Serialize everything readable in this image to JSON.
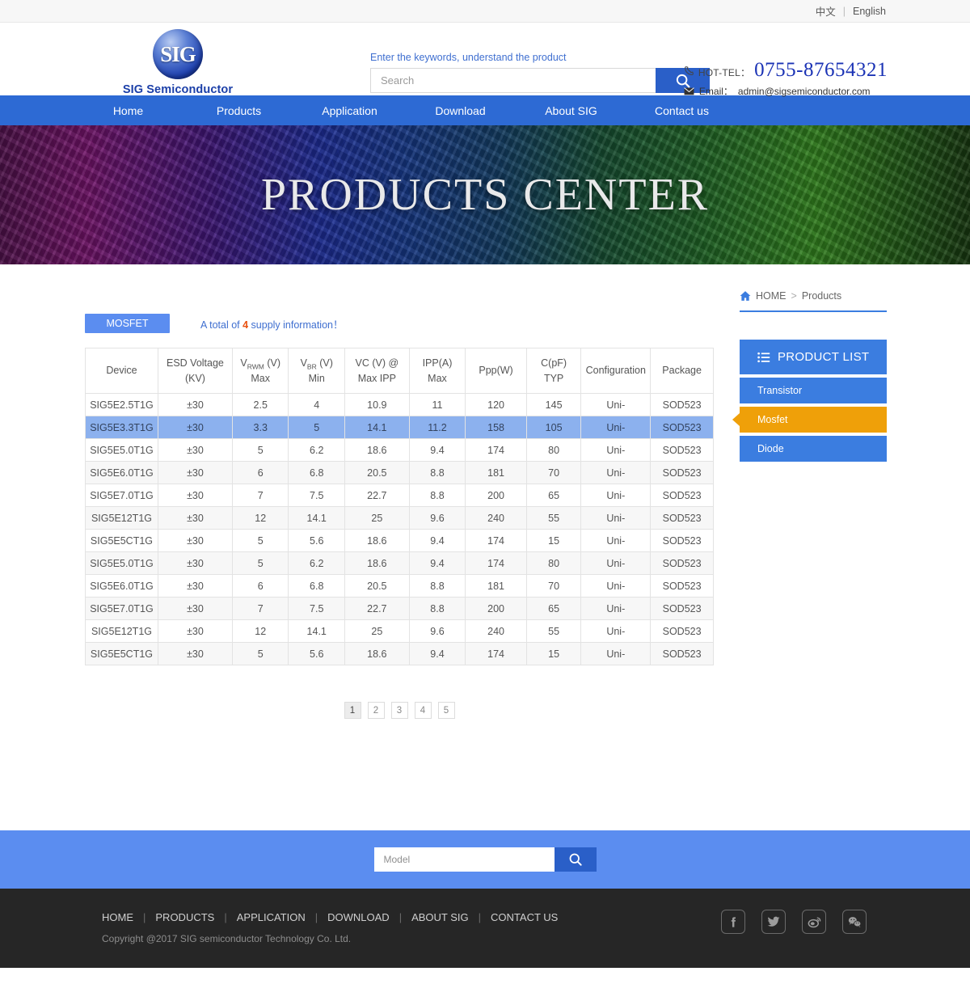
{
  "topbar": {
    "chinese": "中文",
    "separator": "|",
    "english": "English"
  },
  "header": {
    "logo_mark": "SIG",
    "logo_text": "SIG Semiconductor",
    "search_tagline": "Enter the keywords, understand the product",
    "search_placeholder": "Search",
    "search_value": "",
    "tel_label": "HOT-TEL：",
    "tel_number": "0755-87654321",
    "email_label": "Email：",
    "email_value": "admin@sigsemiconductor.com"
  },
  "nav": {
    "items": [
      {
        "label": "Home"
      },
      {
        "label": "Products"
      },
      {
        "label": "Application"
      },
      {
        "label": "Download"
      },
      {
        "label": "About SIG"
      },
      {
        "label": "Contact us"
      }
    ]
  },
  "banner": {
    "title": "PRODUCTS CENTER"
  },
  "content": {
    "tab_label": "MOSFET",
    "total_prefix": "A total of ",
    "total_count": "4",
    "total_suffix": " supply information！",
    "table": {
      "headers": [
        {
          "line1": "Device",
          "line2": ""
        },
        {
          "line1": "ESD Voltage",
          "line2": "(KV)"
        },
        {
          "line1": "V_RWM (V)",
          "line2": "Max",
          "sub_base": "V",
          "sub": "RWM",
          "sub_tail": " (V)"
        },
        {
          "line1": "V_BR (V)",
          "line2": "Min",
          "sub_base": "V",
          "sub": "BR",
          "sub_tail": " (V)"
        },
        {
          "line1": "VC (V) @",
          "line2": "Max IPP"
        },
        {
          "line1": "IPP(A)",
          "line2": "Max"
        },
        {
          "line1": "Ppp(W)",
          "line2": ""
        },
        {
          "line1": "C(pF)",
          "line2": "TYP"
        },
        {
          "line1": "Configuration",
          "line2": ""
        },
        {
          "line1": "Package",
          "line2": ""
        }
      ],
      "rows": [
        {
          "active": false,
          "cells": [
            "SIG5E2.5T1G",
            "±30",
            "2.5",
            "4",
            "10.9",
            "11",
            "120",
            "145",
            "Uni-",
            "SOD523"
          ]
        },
        {
          "active": true,
          "cells": [
            "SIG5E3.3T1G",
            "±30",
            "3.3",
            "5",
            "14.1",
            "11.2",
            "158",
            "105",
            "Uni-",
            "SOD523"
          ]
        },
        {
          "active": false,
          "cells": [
            "SIG5E5.0T1G",
            "±30",
            "5",
            "6.2",
            "18.6",
            "9.4",
            "174",
            "80",
            "Uni-",
            "SOD523"
          ]
        },
        {
          "active": false,
          "cells": [
            "SIG5E6.0T1G",
            "±30",
            "6",
            "6.8",
            "20.5",
            "8.8",
            "181",
            "70",
            "Uni-",
            "SOD523"
          ]
        },
        {
          "active": false,
          "cells": [
            "SIG5E7.0T1G",
            "±30",
            "7",
            "7.5",
            "22.7",
            "8.8",
            "200",
            "65",
            "Uni-",
            "SOD523"
          ]
        },
        {
          "active": false,
          "cells": [
            "SIG5E12T1G",
            "±30",
            "12",
            "14.1",
            "25",
            "9.6",
            "240",
            "55",
            "Uni-",
            "SOD523"
          ]
        },
        {
          "active": false,
          "cells": [
            "SIG5E5CT1G",
            "±30",
            "5",
            "5.6",
            "18.6",
            "9.4",
            "174",
            "15",
            "Uni-",
            "SOD523"
          ]
        },
        {
          "active": false,
          "cells": [
            "SIG5E5.0T1G",
            "±30",
            "5",
            "6.2",
            "18.6",
            "9.4",
            "174",
            "80",
            "Uni-",
            "SOD523"
          ]
        },
        {
          "active": false,
          "cells": [
            "SIG5E6.0T1G",
            "±30",
            "6",
            "6.8",
            "20.5",
            "8.8",
            "181",
            "70",
            "Uni-",
            "SOD523"
          ]
        },
        {
          "active": false,
          "cells": [
            "SIG5E7.0T1G",
            "±30",
            "7",
            "7.5",
            "22.7",
            "8.8",
            "200",
            "65",
            "Uni-",
            "SOD523"
          ]
        },
        {
          "active": false,
          "cells": [
            "SIG5E12T1G",
            "±30",
            "12",
            "14.1",
            "25",
            "9.6",
            "240",
            "55",
            "Uni-",
            "SOD523"
          ]
        },
        {
          "active": false,
          "cells": [
            "SIG5E5CT1G",
            "±30",
            "5",
            "5.6",
            "18.6",
            "9.4",
            "174",
            "15",
            "Uni-",
            "SOD523"
          ]
        }
      ]
    },
    "pagination": {
      "pages": [
        "1",
        "2",
        "3",
        "4",
        "5"
      ],
      "current": "1"
    }
  },
  "sidebar": {
    "breadcrumb": {
      "home": "HOME",
      "separator": ">",
      "current": "Products"
    },
    "list_title": "PRODUCT LIST",
    "items": [
      {
        "label": "Transistor",
        "active": false
      },
      {
        "label": "Mosfet",
        "active": true
      },
      {
        "label": "Diode",
        "active": false
      }
    ]
  },
  "band": {
    "placeholder": "Model",
    "value": ""
  },
  "footer": {
    "links": [
      "HOME",
      "PRODUCTS",
      "APPLICATION",
      "DOWNLOAD",
      "ABOUT SIG",
      "CONTACT US"
    ],
    "separator": "|",
    "copyright": "Copyright @2017  SIG semiconductor Technology Co. Ltd.",
    "social": [
      "facebook-icon",
      "twitter-icon",
      "weibo-icon",
      "wechat-icon"
    ]
  },
  "colors": {
    "brand_blue": "#2d6ad4",
    "light_blue": "#5b8df0",
    "accent_orange": "#efa009",
    "count_red": "#e8500f",
    "row_highlight": "#8cb1ee",
    "footer_dark": "#262626"
  }
}
